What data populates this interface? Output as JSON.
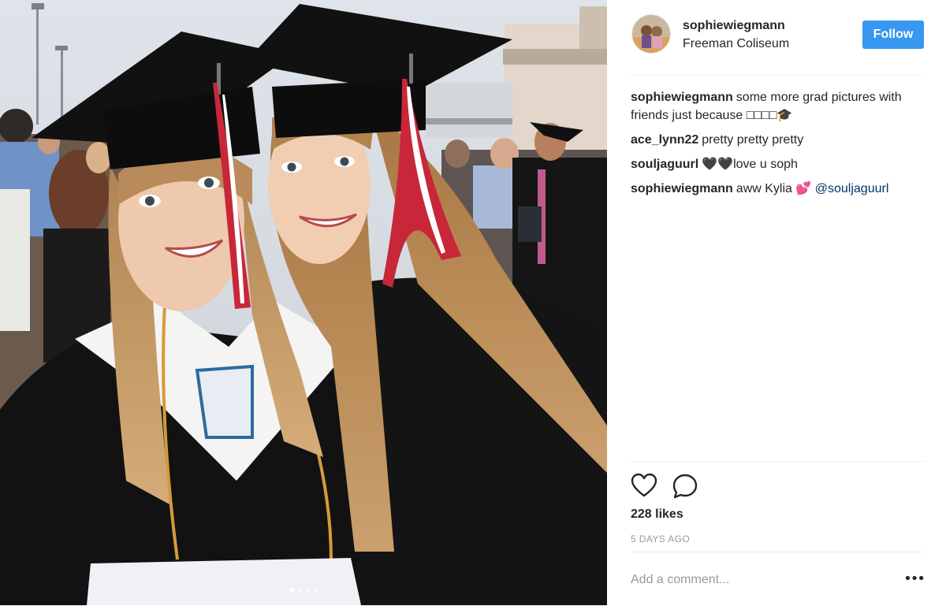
{
  "post": {
    "photo_alt": "Two graduates in caps and gowns",
    "carousel": {
      "count": 4,
      "active_index": 0
    }
  },
  "header": {
    "username": "sophiewiegmann",
    "location": "Freeman Coliseum",
    "follow_label": "Follow"
  },
  "comments": [
    {
      "user": "sophiewiegmann",
      "text": "some more grad pictures with friends just because □□□□🎓"
    },
    {
      "user": "ace_lynn22",
      "text": "pretty pretty pretty"
    },
    {
      "user": "souljaguurl",
      "text": "🖤🖤love u soph"
    },
    {
      "user": "sophiewiegmann",
      "text": "aww Kylia 💕 ",
      "mention": "@souljaguurl"
    }
  ],
  "actions": {
    "like_icon": "heart-icon",
    "comment_icon": "speech-bubble-icon",
    "likes": "228 likes",
    "time_ago": "5 DAYS AGO"
  },
  "comment_box": {
    "placeholder": "Add a comment...",
    "more_label": "•••"
  },
  "colors": {
    "accent": "#3897f0",
    "mention": "#003569",
    "muted": "#999999"
  }
}
